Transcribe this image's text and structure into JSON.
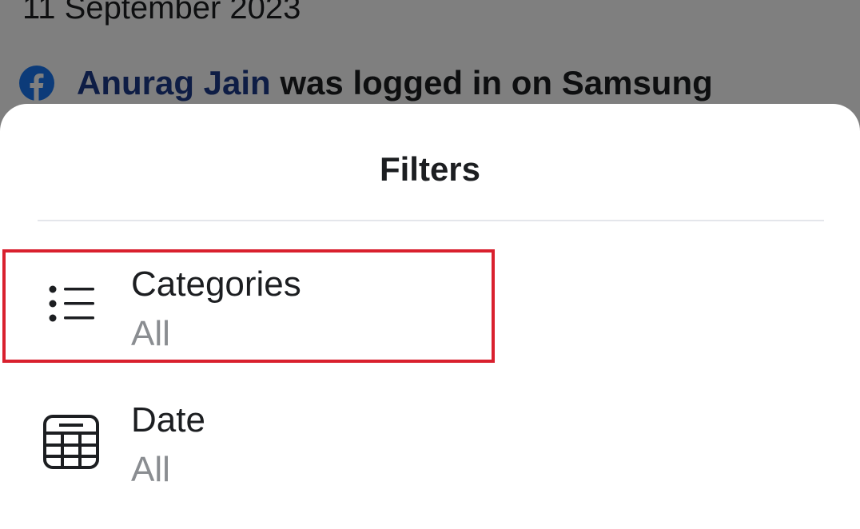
{
  "background": {
    "date_heading": "11 September 2023",
    "entry": {
      "icon": "facebook-icon",
      "name": "Anurag Jain",
      "text": " was logged in on Samsung"
    }
  },
  "sheet": {
    "title": "Filters",
    "filters": [
      {
        "label": "Categories",
        "value": "All",
        "icon": "list-icon",
        "highlighted": true
      },
      {
        "label": "Date",
        "value": "All",
        "icon": "calendar-icon",
        "highlighted": false
      }
    ]
  },
  "colors": {
    "facebook_blue": "#1877f2",
    "name_link": "#1d3a8a",
    "highlight_border": "#d9202e",
    "secondary_text": "#8a8d91"
  }
}
